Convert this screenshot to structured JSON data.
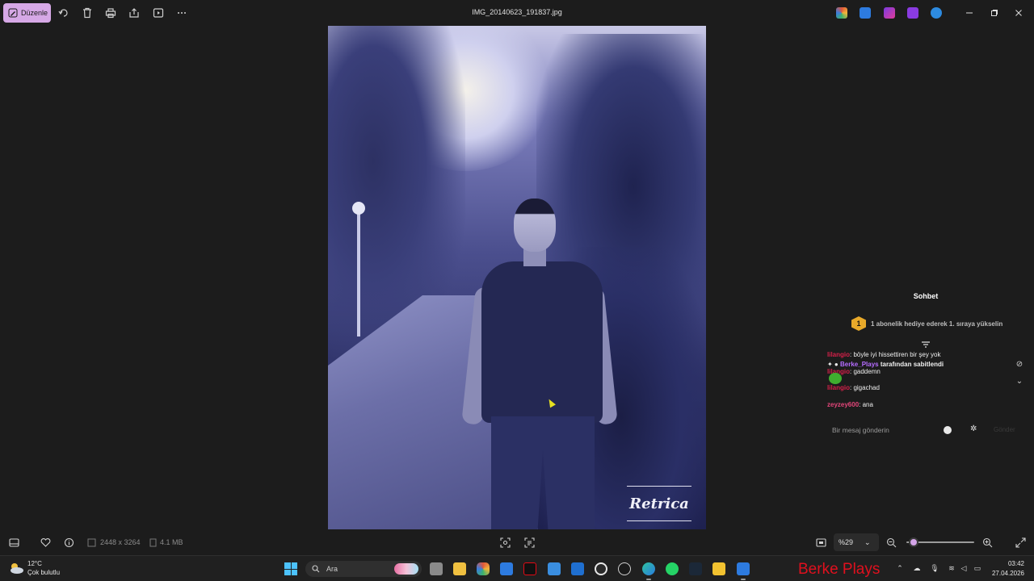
{
  "toolbar": {
    "edit_label": "Düzenle",
    "file_title": "IMG_20140623_191837.jpg"
  },
  "photo": {
    "watermark": "Retrica"
  },
  "chat": {
    "title": "Sohbet",
    "gift_rank": "1",
    "gift_banner": "1 abonelik hediye ederek 1. sıraya yükselin",
    "messages": [
      {
        "user": "lilangio",
        "text": ": böyle iyi hissettiren bir şey yok",
        "color": "#d6204a"
      },
      {
        "pinned_by": "Berke_Plays",
        "pinned_suffix": "tarafından sabitlendi"
      },
      {
        "user": "lilangio",
        "text": ": gaddemn",
        "color": "#d6204a"
      },
      {
        "user": "lilangio",
        "text": ": gigachad",
        "color": "#d6204a"
      },
      {
        "user": "zeyzey600",
        "text": ": ana",
        "color": "#e4467a"
      }
    ],
    "input_placeholder": "Bir mesaj gönderin",
    "send_label": "Gönder"
  },
  "bottombar": {
    "dimensions": "2448 x 3264",
    "file_size": "4.1 MB",
    "zoom": "%29",
    "zoom_level_percent": 29
  },
  "taskbar": {
    "temperature": "12°C",
    "weather": "Çok bulutlu",
    "search_placeholder": "Ara",
    "streamer_name": "Berke Plays",
    "time": "03:42",
    "date": "27.04.2026"
  },
  "colors": {
    "accent": "#d6a8e6",
    "username_red": "#d6204a",
    "streamer_red": "#e0101e",
    "gift_badge": "#e8a92a",
    "pinned_purple": "#b56cff"
  }
}
